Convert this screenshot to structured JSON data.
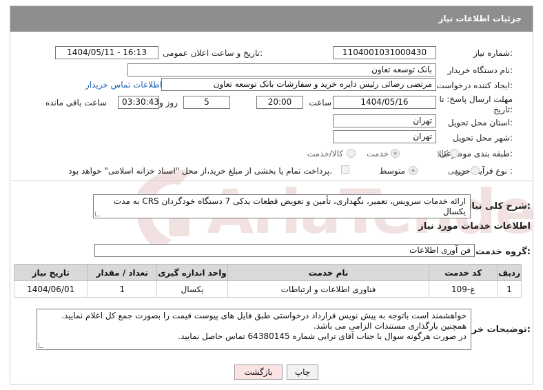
{
  "header": {
    "title": "جزئیات اطلاعات نیاز"
  },
  "need": {
    "number_label": "شماره نیاز:",
    "number_value": "1104001031000430",
    "announce_label": "تاریخ و ساعت اعلان عمومی:",
    "announce_value": "1404/05/11 - 16:13",
    "buyer_label": "نام دستگاه خریدار:",
    "buyer_value": "بانک توسعه تعاون",
    "creator_label": "ایجاد کننده درخواست:",
    "creator_value": "مرتضی رضائی رئیس دایره خرید و سفارشات بانک توسعه تعاون",
    "contact_link": "اطلاعات تماس خریدار",
    "deadline_label": "مهلت ارسال پاسخ: تا تاریخ:",
    "deadline_date": "1404/05/16",
    "time_label": "ساعت",
    "deadline_time": "20:00",
    "days_value": "5",
    "days_label": "روز و",
    "remaining_time": "03:30:43",
    "remaining_label": "ساعت باقی مانده",
    "province_label": "استان محل تحویل:",
    "province_value": "تهران",
    "city_label": "شهر محل تحویل:",
    "city_value": "تهران",
    "category_label": "طبقه بندی موضوعی:",
    "category_options": [
      "کالا",
      "خدمت",
      "کالا/خدمت"
    ],
    "process_label": "نوع فرآیند خرید :",
    "process_options": [
      "جزیی",
      "متوسط"
    ],
    "payment_note": "پرداخت تمام یا بخشی از مبلغ خرید،از محل \"اسناد خزانه اسلامی\" خواهد بود."
  },
  "summary": {
    "label": "شرح کلی نیاز:",
    "text": "ارائه خدمات سرویس، تعمیر، نگهداری، تأمین و تعویض قطعات یدکی 7 دستگاه خودگردان CRS به مدت یکسال"
  },
  "services": {
    "section_title": "اطلاعات خدمات مورد نیاز",
    "group_label": "گروه خدمت:",
    "group_value": "فن آوری اطلاعات",
    "columns": [
      "ردیف",
      "کد خدمت",
      "نام خدمت",
      "واحد اندازه گیری",
      "تعداد / مقدار",
      "تاریخ نیاز"
    ],
    "rows": [
      [
        "1",
        "غ-109",
        "فناوری اطلاعات و ارتباطات",
        "یکسال",
        "1",
        "1404/06/01"
      ]
    ]
  },
  "buyer_notes": {
    "label": "توضیحات خریدار:",
    "lines": [
      "خواهشمند است باتوجه به پیش نویس قرارداد درخواستی طبق فایل های پیوست قیمت را بصورت جمع کل اعلام نمایید.",
      "همچنین بارگذاری مستندات الزامی می باشد.",
      "در صورت هرگونه سوال با جناب آقای ترابی شماره 64380145 تماس حاصل نمایید."
    ]
  },
  "buttons": {
    "print": "چاپ",
    "back": "بازگشت"
  },
  "colors": {
    "titlebar": "#8e8e8e",
    "link": "#1a5fb4",
    "back_button": "#fbe3e3",
    "watermark": "#d9a3a3"
  }
}
